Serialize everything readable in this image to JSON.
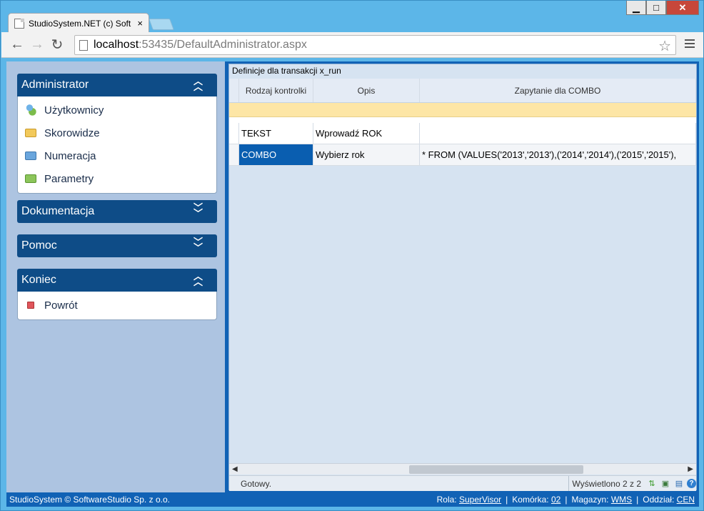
{
  "browser": {
    "tab_title": "StudioSystem.NET (c) Soft",
    "tab_close": "×",
    "url_host": "localhost",
    "url_rest": ":53435/DefaultAdministrator.aspx",
    "window_controls": {
      "minimize": "▁",
      "maximize": "□",
      "close": "✕"
    }
  },
  "sidebar": {
    "panels": [
      {
        "title": "Administrator",
        "expanded": true,
        "items": [
          {
            "label": "Użytkownicy",
            "icon": "users-icon"
          },
          {
            "label": "Skorowidze",
            "icon": "folder-yellow-icon"
          },
          {
            "label": "Numeracja",
            "icon": "folder-blue-icon"
          },
          {
            "label": "Parametry",
            "icon": "folder-green-icon"
          }
        ]
      },
      {
        "title": "Dokumentacja",
        "expanded": false,
        "items": []
      },
      {
        "title": "Pomoc",
        "expanded": false,
        "items": []
      },
      {
        "title": "Koniec",
        "expanded": true,
        "items": [
          {
            "label": "Powrót",
            "icon": "stop-icon"
          }
        ]
      }
    ]
  },
  "grid": {
    "title": "Definicje dla transakcji x_run",
    "columns": [
      "Rodzaj kontrolki",
      "Opis",
      "Zapytanie dla COMBO"
    ],
    "rows": [
      [
        "TEKST",
        "Wprowadź ROK",
        ""
      ],
      [
        "COMBO",
        "Wybierz rok",
        "* FROM (VALUES('2013','2013'),('2014','2014'),('2015','2015'),"
      ]
    ],
    "selected_row": 1,
    "status_left": "Gotowy.",
    "status_right": "Wyświetlono 2 z 2"
  },
  "footer": {
    "copyright": "StudioSystem © SoftwareStudio Sp. z o.o.",
    "rola_label": "Rola:",
    "rola_value": "SuperVisor",
    "komorka_label": "Komórka:",
    "komorka_value": "02",
    "magazyn_label": "Magazyn:",
    "magazyn_value": "WMS",
    "oddzial_label": "Oddział:",
    "oddzial_value": "CEN"
  }
}
